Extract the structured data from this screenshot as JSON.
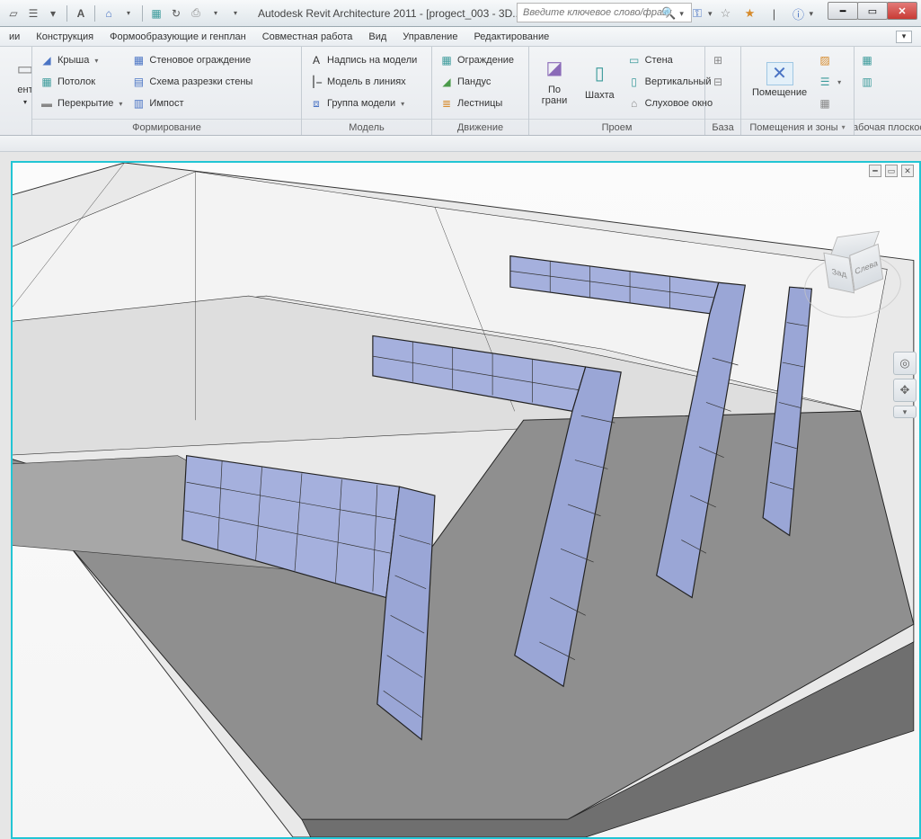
{
  "titlebar": {
    "app_title": "Autodesk Revit Architecture 2011 - [progect_003 - 3D...",
    "search_placeholder": "Введите ключевое слово/фразу"
  },
  "menubar": {
    "items": [
      "ии",
      "Конструкция",
      "Формообразующие и генплан",
      "Совместная работа",
      "Вид",
      "Управление",
      "Редактирование"
    ]
  },
  "ribbon": {
    "panel_component": {
      "label": "ент",
      "title": "Формирование"
    },
    "panel_form": {
      "roof": "Крыша",
      "ceiling": "Потолок",
      "floor": "Перекрытие",
      "curtain_wall": "Стеновое ограждение",
      "curtain_grid": "Схема разрезки стены",
      "mullion": "Импост",
      "title": "Формирование"
    },
    "panel_model": {
      "model_text": "Надпись на модели",
      "model_line": "Модель в линиях",
      "model_group": "Группа модели",
      "title": "Модель"
    },
    "panel_motion": {
      "railing": "Ограждение",
      "ramp": "Пандус",
      "stairs": "Лестницы",
      "title": "Движение"
    },
    "panel_opening": {
      "by_face_top": "По",
      "by_face_bottom": "грани",
      "shaft": "Шахта",
      "wall": "Стена",
      "vertical": "Вертикальный",
      "dormer": "Слуховое окно",
      "title": "Проем"
    },
    "panel_base": {
      "title": "База"
    },
    "panel_room": {
      "room": "Помещение",
      "title": "Помещения и зоны"
    },
    "panel_workplane": {
      "title": "Рабочая плоскост"
    }
  },
  "viewcube": {
    "back": "Зад",
    "left": "Слева"
  }
}
